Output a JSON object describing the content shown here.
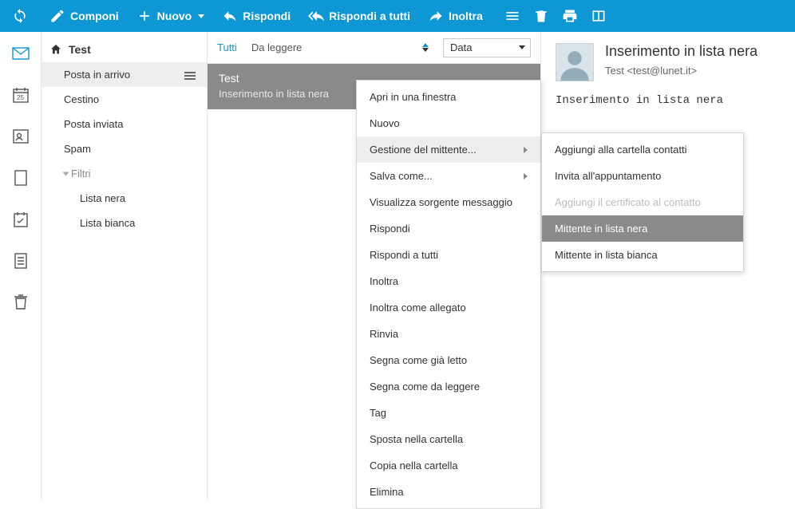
{
  "toolbar": {
    "compose": "Componi",
    "new": "Nuovo",
    "reply": "Rispondi",
    "reply_all": "Rispondi a tutti",
    "forward": "Inoltra"
  },
  "folder_root": "Test",
  "folders": {
    "inbox": "Posta in arrivo",
    "trash": "Cestino",
    "sent": "Posta inviata",
    "spam": "Spam",
    "filters_label": "Filtri",
    "blacklist": "Lista nera",
    "whitelist": "Lista bianca"
  },
  "list": {
    "tab_all": "Tutti",
    "tab_unread": "Da leggere",
    "sort_field": "Data"
  },
  "message": {
    "subject": "Test",
    "preview": "Inserimento in lista nera"
  },
  "reading": {
    "title": "Inserimento in lista nera",
    "from": "Test <test@lunet.it>",
    "body": "Inserimento in lista nera"
  },
  "context_menu": {
    "open_window": "Apri in una finestra",
    "new": "Nuovo",
    "manage_sender": "Gestione del mittente...",
    "save_as": "Salva come...",
    "view_source": "Visualizza sorgente messaggio",
    "reply": "Rispondi",
    "reply_all": "Rispondi a tutti",
    "forward": "Inoltra",
    "forward_attach": "Inoltra come allegato",
    "resend": "Rinvia",
    "mark_read": "Segna come già letto",
    "mark_unread": "Segna come da leggere",
    "tag": "Tag",
    "move_to": "Sposta nella cartella",
    "copy_to": "Copia nella cartella",
    "delete": "Elimina"
  },
  "submenu": {
    "add_contact": "Aggiungi alla cartella contatti",
    "invite": "Invita all'appuntamento",
    "add_cert": "Aggiungi il certificato al contatto",
    "blacklist_sender": "Mittente in lista nera",
    "whitelist_sender": "Mittente in lista bianca"
  }
}
